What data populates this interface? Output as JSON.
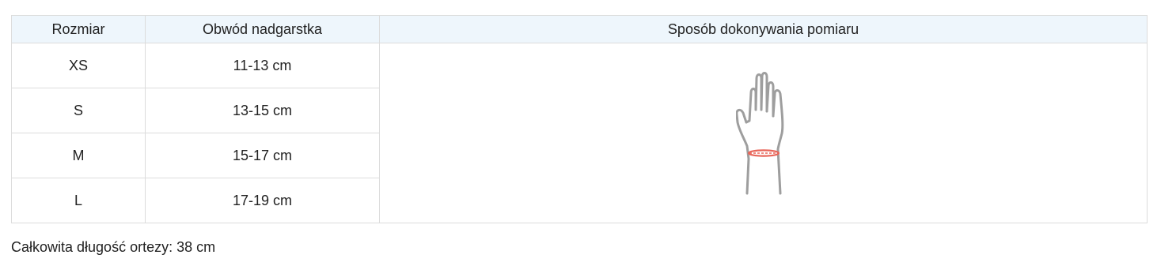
{
  "table": {
    "headers": {
      "size": "Rozmiar",
      "circumference": "Obwód nadgarstka",
      "method": "Sposób dokonywania pomiaru"
    },
    "rows": [
      {
        "size": "XS",
        "circumference": "11-13 cm"
      },
      {
        "size": "S",
        "circumference": "13-15 cm"
      },
      {
        "size": "M",
        "circumference": "15-17 cm"
      },
      {
        "size": "L",
        "circumference": "17-19 cm"
      }
    ],
    "illustration": {
      "icon": "wrist-measurement-icon",
      "hand_color": "#9e9e9e",
      "measure_color": "#e8665a"
    }
  },
  "footnote": "Całkowita długość ortezy: 38 cm"
}
